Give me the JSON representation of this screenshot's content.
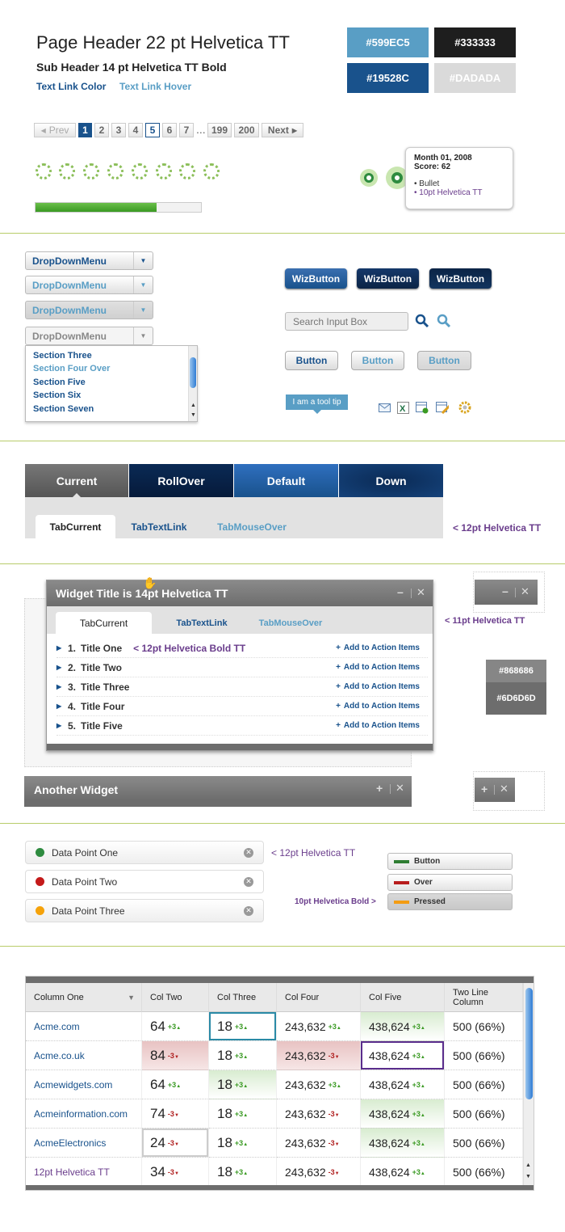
{
  "header": {
    "title": "Page Header 22 pt Helvetica TT",
    "subtitle": "Sub Header 14 pt Helvetica TT Bold",
    "link": "Text Link Color",
    "link_hover": "Text Link Hover"
  },
  "swatches": [
    {
      "label": "#599EC5",
      "color": "#599EC5"
    },
    {
      "label": "#333333",
      "color": "#333333"
    },
    {
      "label": "#19528C",
      "color": "#19528C"
    },
    {
      "label": "#DADADA",
      "color": "#DADADA"
    }
  ],
  "pagination": {
    "prev": "Prev",
    "pages": [
      "1",
      "2",
      "3",
      "4",
      "5",
      "6",
      "7"
    ],
    "ellipsis": "...",
    "last": [
      "199",
      "200"
    ],
    "next": "Next",
    "current": "1",
    "selected": "5"
  },
  "progress": {
    "value": 0.73
  },
  "tooltip": {
    "date": "Month 01, 2008",
    "score": "Score: 62",
    "bullet1": "• Bullet",
    "bullet2": "• 10pt Helvetica TT"
  },
  "dropdowns": [
    "DropDownMenu",
    "DropDownMenu",
    "DropDownMenu",
    "DropDownMenu"
  ],
  "dropdown_list": [
    "Section Three",
    "Section Four Over",
    "Section Five",
    "Section Six",
    "Section Seven"
  ],
  "wizbuttons": [
    "WizButton",
    "WizButton",
    "WizButton"
  ],
  "search": {
    "placeholder": "Search Input Box"
  },
  "buttons": [
    "Button",
    "Button",
    "Button"
  ],
  "tooltip_small": "I am a tool tip",
  "icons": [
    "mail-icon",
    "excel-icon",
    "add-table-icon",
    "edit-table-icon",
    "settings-icon"
  ],
  "main_tabs": [
    "Current",
    "RollOver",
    "Default",
    "Down"
  ],
  "sub_tabs": [
    "TabCurrent",
    "TabTextLink",
    "TabMouseOver"
  ],
  "tab_note": "< 12pt Helvetica TT",
  "widget": {
    "title": "Widget Title is 14pt Helvetica TT",
    "tabs": [
      "TabCurrent",
      "TabTextLink",
      "TabMouseOver"
    ],
    "tab_note": "< 11pt Helvetica TT",
    "rows": [
      {
        "num": "1.",
        "title": "Title One"
      },
      {
        "num": "2.",
        "title": "Title Two"
      },
      {
        "num": "3.",
        "title": "Title Three"
      },
      {
        "num": "4.",
        "title": "Title Four"
      },
      {
        "num": "5.",
        "title": "Title Five"
      }
    ],
    "row_note": "< 12pt Helvetica Bold TT",
    "action": "Add to Action Items",
    "minus": "–",
    "close": "✕"
  },
  "widget_colors": [
    {
      "label": "#868686",
      "color": "#868686"
    },
    {
      "label": "#6D6D6D",
      "color": "#6D6D6D"
    }
  ],
  "another_widget": {
    "title": "Another Widget",
    "plus": "+",
    "close": "✕"
  },
  "data_points": [
    {
      "label": "Data Point One",
      "color": "#2e8b3f"
    },
    {
      "label": "Data Point Two",
      "color": "#c41a1a"
    },
    {
      "label": "Data Point Three",
      "color": "#f5a20a"
    }
  ],
  "dp_note": "< 12pt Helvetica TT",
  "legend_note": "10pt Helvetica Bold >",
  "legend_buttons": [
    {
      "label": "Button",
      "color": "#2e7d32"
    },
    {
      "label": "Over",
      "color": "#b71c1c"
    },
    {
      "label": "Pressed",
      "color": "#f39c12"
    }
  ],
  "table": {
    "headers": [
      "Column One",
      "Col Two",
      "Col Three",
      "Col Four",
      "Col Five",
      "Two Line\nColumn"
    ],
    "rows": [
      {
        "c1": "Acme.com",
        "c2": "64",
        "d2": "+3",
        "c3": "18",
        "d3": "+3",
        "c4": "243,632",
        "d4": "+3",
        "c5": "438,624",
        "d5": "+3",
        "c6": "500 (66%)"
      },
      {
        "c1": "Acme.co.uk",
        "c2": "84",
        "d2": "-3",
        "c3": "18",
        "d3": "+3",
        "c4": "243,632",
        "d4": "-3",
        "c5": "438,624",
        "d5": "+3",
        "c6": "500 (66%)"
      },
      {
        "c1": "Acmewidgets.com",
        "c2": "64",
        "d2": "+3",
        "c3": "18",
        "d3": "+3",
        "c4": "243,632",
        "d4": "+3",
        "c5": "438,624",
        "d5": "+3",
        "c6": "500 (66%)"
      },
      {
        "c1": "Acmeinformation.com",
        "c2": "74",
        "d2": "-3",
        "c3": "18",
        "d3": "+3",
        "c4": "243,632",
        "d4": "-3",
        "c5": "438,624",
        "d5": "+3",
        "c6": "500 (66%)"
      },
      {
        "c1": "AcmeElectronics",
        "c2": "24",
        "d2": "-3",
        "c3": "18",
        "d3": "+3",
        "c4": "243,632",
        "d4": "-3",
        "c5": "438,624",
        "d5": "+3",
        "c6": "500 (66%)"
      },
      {
        "c1": "12pt Helvetica TT",
        "c2": "34",
        "d2": "-3",
        "c3": "18",
        "d3": "+3",
        "c4": "243,632",
        "d4": "-3",
        "c5": "438,624",
        "d5": "+3",
        "c6": "500 (66%)"
      }
    ]
  }
}
